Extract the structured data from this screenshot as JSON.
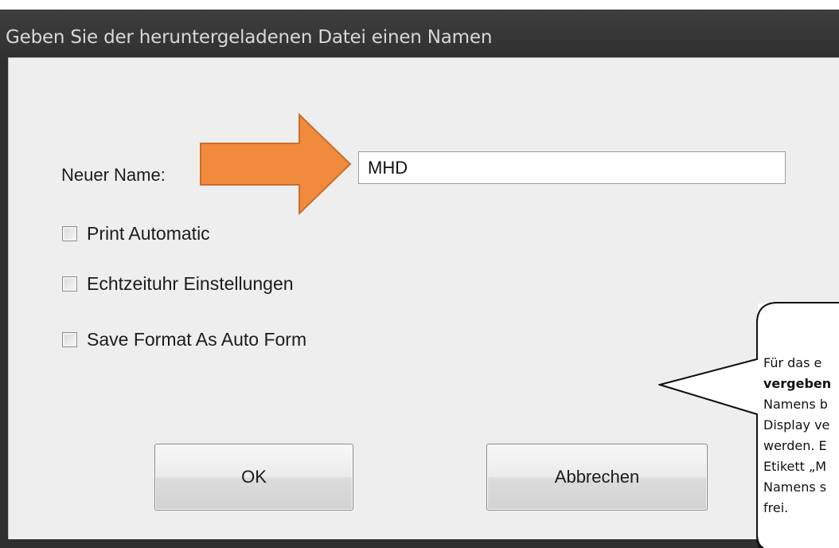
{
  "dialog": {
    "title": "Geben Sie der heruntergeladenen Datei einen Namen",
    "name_label": "Neuer Name:",
    "name_value": "MHD",
    "checkboxes": [
      {
        "label": "Print Automatic",
        "checked": false
      },
      {
        "label": "Echtzeituhr Einstellungen",
        "checked": false
      },
      {
        "label": "Save Format As Auto Form",
        "checked": false
      }
    ],
    "ok_label": "OK",
    "cancel_label": "Abbrechen"
  },
  "annotation": {
    "arrow_color": "#f08a3c",
    "arrow_icon": "arrow-right-icon",
    "callout_lines": [
      {
        "text": "Für das e",
        "bold": false
      },
      {
        "text": "vergeben",
        "bold": true
      },
      {
        "text": "Namens b",
        "bold": false
      },
      {
        "text": "Display ve",
        "bold": false
      },
      {
        "text": "werden. E",
        "bold": false
      },
      {
        "text": "Etikett „M",
        "bold": false
      },
      {
        "text": "Namens s",
        "bold": false
      },
      {
        "text": "frei.",
        "bold": false
      }
    ]
  }
}
